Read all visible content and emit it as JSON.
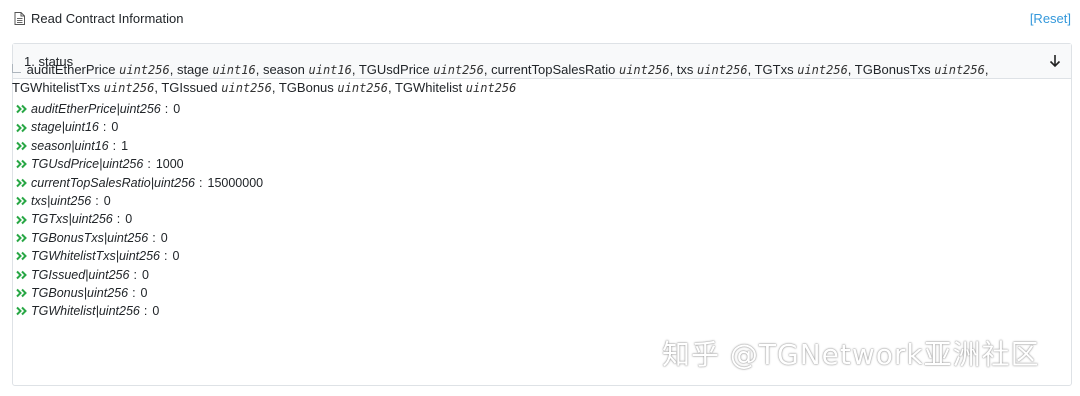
{
  "header": {
    "title": "Read Contract Information",
    "reset_label": "[Reset]",
    "doc_icon": "document-icon"
  },
  "card": {
    "title": "1. status",
    "arrow_icon": "arrow-down-icon"
  },
  "signature": [
    {
      "name": "auditEtherPrice",
      "type": "uint256"
    },
    {
      "name": "stage",
      "type": "uint16"
    },
    {
      "name": "season",
      "type": "uint16"
    },
    {
      "name": "TGUsdPrice",
      "type": "uint256"
    },
    {
      "name": "currentTopSalesRatio",
      "type": "uint256"
    },
    {
      "name": "txs",
      "type": "uint256"
    },
    {
      "name": "TGTxs",
      "type": "uint256"
    },
    {
      "name": "TGBonusTxs",
      "type": "uint256"
    },
    {
      "name": "TGWhitelistTxs",
      "type": "uint256"
    },
    {
      "name": "TGIssued",
      "type": "uint256"
    },
    {
      "name": "TGBonus",
      "type": "uint256"
    },
    {
      "name": "TGWhitelist",
      "type": "uint256"
    }
  ],
  "results": [
    {
      "label": "auditEtherPrice|uint256",
      "value": "0"
    },
    {
      "label": "stage|uint16",
      "value": "0"
    },
    {
      "label": "season|uint16",
      "value": "1"
    },
    {
      "label": "TGUsdPrice|uint256",
      "value": "1000"
    },
    {
      "label": "currentTopSalesRatio|uint256",
      "value": "15000000"
    },
    {
      "label": "txs|uint256",
      "value": "0"
    },
    {
      "label": "TGTxs|uint256",
      "value": "0"
    },
    {
      "label": "TGBonusTxs|uint256",
      "value": "0"
    },
    {
      "label": "TGWhitelistTxs|uint256",
      "value": "0"
    },
    {
      "label": "TGIssued|uint256",
      "value": "0"
    },
    {
      "label": "TGBonus|uint256",
      "value": "0"
    },
    {
      "label": "TGWhitelist|uint256",
      "value": "0"
    }
  ],
  "watermark": "知乎 @TGNetwork亚洲社区",
  "colors": {
    "link": "#3498db",
    "chevron": "#28a745",
    "border": "#dee2e6",
    "card_header_bg": "#f8f9fa"
  }
}
